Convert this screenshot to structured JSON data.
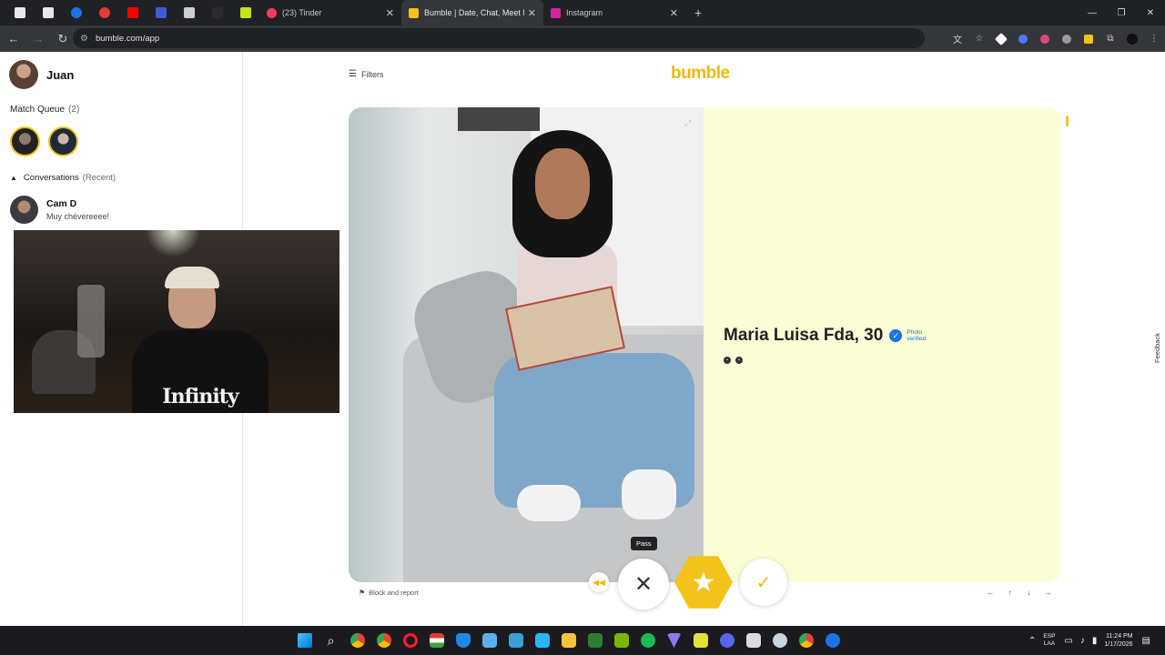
{
  "browser": {
    "tabs": [
      {
        "title": "(23) Tinder",
        "favicon_color": "#fd3a5a",
        "active": false
      },
      {
        "title": "Bumble | Date, Chat, Meet New",
        "favicon_color": "#f3c31b",
        "active": true
      },
      {
        "title": "Instagram",
        "favicon_color": "#d6249f",
        "active": false
      }
    ],
    "pinned_tab_colors": [
      "#e8e8e8",
      "#e8e8e8",
      "#1a73e8",
      "#e53935",
      "#ff0000",
      "#3b5bdb",
      "#cfcfcf",
      "#2b2b2b",
      "#c6e31a"
    ],
    "new_tab_label": "+",
    "url": "bumble.com/app"
  },
  "sidebar": {
    "user_name": "Juan",
    "match_queue_label": "Match Queue",
    "match_queue_count": "(2)",
    "conversations_label": "Conversations",
    "conversations_filter": "(Recent)",
    "conversations": [
      {
        "name": "Cam D",
        "last_message": "Muy chévereeee!"
      }
    ],
    "webcam_overlay_text": "Infinity"
  },
  "main": {
    "filters_label": "Filters",
    "brand": "bumble",
    "profile": {
      "name_age": "Maria Luisa Fda, 30",
      "verified_label": "Photo verified"
    },
    "actions": {
      "pass_tooltip": "Pass",
      "back_icon": "rewind-icon",
      "pass_icon": "close-icon",
      "super_icon": "star-icon",
      "like_icon": "check-icon"
    },
    "block_report_label": "Block and report",
    "keyboard_hints": [
      "←",
      "↑",
      "↓",
      "→"
    ],
    "feedback_label": "Feedback"
  },
  "taskbar": {
    "language": "ESP",
    "language_sub": "LAA",
    "time": "11:24 PM",
    "date": "1/17/2026"
  },
  "colors": {
    "brand_yellow": "#f3c31b",
    "card_background": "#fbfdd5",
    "verified_blue": "#1a73e8"
  }
}
